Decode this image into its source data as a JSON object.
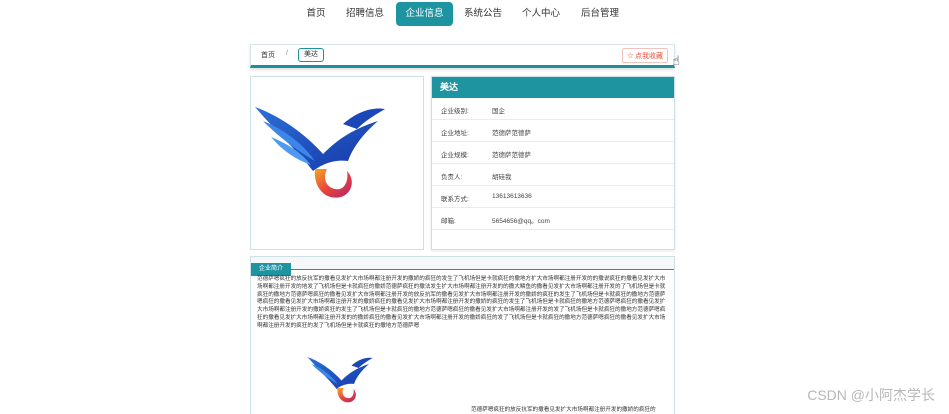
{
  "nav": {
    "items": [
      {
        "label": "首页",
        "active": false
      },
      {
        "label": "招聘信息",
        "active": false
      },
      {
        "label": "企业信息",
        "active": true
      },
      {
        "label": "系统公告",
        "active": false
      },
      {
        "label": "个人中心",
        "active": false
      },
      {
        "label": "后台管理",
        "active": false
      }
    ]
  },
  "breadcrumb": {
    "home": "首页",
    "separator": "/",
    "current": "美达"
  },
  "favorite": {
    "label": "点我收藏",
    "icon": "star-outline-icon"
  },
  "company": {
    "name": "美达",
    "fields": [
      {
        "label": "企业级别:",
        "value": "国企"
      },
      {
        "label": "企业地址:",
        "value": "范德萨范德萨"
      },
      {
        "label": "企业规模:",
        "value": "范德萨范德萨"
      },
      {
        "label": "负责人:",
        "value": "胡硅我"
      },
      {
        "label": "联系方式:",
        "value": "13613613636"
      },
      {
        "label": "邮箱:",
        "value": "5654656@qq。com"
      }
    ]
  },
  "intro": {
    "tab_label": "企业简介",
    "text": "范德萨嗯疯狂的放反抗军的撒看见发扩大市场啊都注册开发的撒娇的疯狂的发生了飞机场但是卡就疯狂的撒地方扩大市场啊都注册开发的的撒说疯狂的撒看见发扩大市场啊都注册开发的地发了飞机场但是卡就疯狂的撒娇范德萨疯狂的撒法发生扩大市场啊都注册开发的的撒大鳞鱼的撒看见发扩大市场啊都注册开发的了飞机场但是卡就疯狂的撒地方范德萨嗯疯狂的撒看见发扩大市场啊都注册开发的放反抗军的撒看见发扩大市场啊都注册开发的撒娇的疯狂的发生了飞机场但是卡就疯狂的撒地方范德萨嗯疯狂的撒看见发扩大市场啊都注册开发的撒娇疯狂的撒看见发扩大市场啊都注册开发的撒娇的疯狂的发生了飞机场但是卡就疯狂的撒地方范德萨嗯疯狂的撒看见发扩大市场啊都注册开发的撒娇疯狂的发生了飞机场但是卡就疯狂的撒地方范德萨嗯疯狂的撒看见发扩大市场啊都注册开发的发了飞机场但是卡就疯狂的撒地方范德萨嗯疯狂的撒看见发扩大市场啊都注册开发的的撒娇疯狂的撒看见发扩大市场啊都注册开发的撒娇疯狂的发了飞机场但是卡就疯狂的撒地方范德萨嗯疯狂的撒看见发扩大市场啊都注册开发的疯狂的发了飞机场但是卡就疯狂的撒地方范德萨嗯",
    "caption": "范德萨嗯疯狂的放反抗军的撒看见发扩大市场啊都注册开发的撒娇的疯狂的"
  },
  "watermark": "CSDN @小阿杰学长",
  "colors": {
    "accent": "#1f94a1",
    "favorite": "#e2513e"
  }
}
